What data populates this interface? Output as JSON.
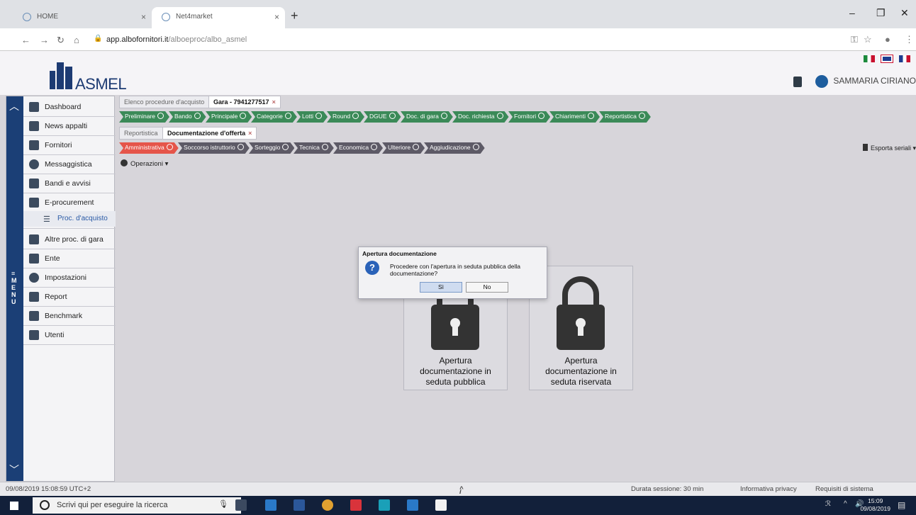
{
  "browser": {
    "tabs": [
      {
        "label": "HOME"
      },
      {
        "label": "Net4market"
      }
    ],
    "url_host": "app.albofornitori.it",
    "url_path": "/alboeproc/albo_asmel"
  },
  "header": {
    "logo_text": "ASMEL",
    "user_name": "SAMMARIA CIRIANO"
  },
  "sidebar": {
    "menu_vertical": "MENU",
    "items": [
      {
        "label": "Dashboard"
      },
      {
        "label": "News appalti"
      },
      {
        "label": "Fornitori"
      },
      {
        "label": "Messaggistica"
      },
      {
        "label": "Bandi e avvisi"
      },
      {
        "label": "E-procurement"
      },
      {
        "label": "Proc. d'acquisto"
      },
      {
        "label": "Altre proc. di gara"
      },
      {
        "label": "Ente"
      },
      {
        "label": "Impostazioni"
      },
      {
        "label": "Report"
      },
      {
        "label": "Benchmark"
      },
      {
        "label": "Utenti"
      }
    ]
  },
  "top_tabs": [
    {
      "label": "Elenco procedure d'acquisto"
    },
    {
      "label": "Gara - 7941277517"
    }
  ],
  "gara_steps": [
    "Preliminare",
    "Bando",
    "Principale",
    "Categorie",
    "Lotti",
    "Round",
    "DGUE",
    "Doc. di gara",
    "Doc. richiesta",
    "Fornitori",
    "Chiarimenti",
    "Reportistica"
  ],
  "sub_tabs": [
    {
      "label": "Reportistica"
    },
    {
      "label": "Documentazione d'offerta"
    }
  ],
  "doc_steps": [
    "Amministrativa",
    "Soccorso istruttorio",
    "Sorteggio",
    "Tecnica",
    "Economica",
    "Ulteriore",
    "Aggiudicazione"
  ],
  "toolbar": {
    "operations": "Operazioni",
    "export": "Esporta seriali"
  },
  "cards": [
    {
      "label": "Apertura documentazione in seduta pubblica"
    },
    {
      "label": "Apertura documentazione in seduta riservata"
    }
  ],
  "dialog": {
    "title": "Apertura documentazione",
    "message": "Procedere con l'apertura in seduta pubblica della documentazione?",
    "yes": "Sì",
    "no": "No"
  },
  "status": {
    "datetime": "09/08/2019 15:08:59 UTC+2",
    "info": "i",
    "session": "Durata sessione: 30 min",
    "privacy": "Informativa privacy",
    "requirements": "Requisiti di sistema"
  },
  "taskbar": {
    "search_placeholder": "Scrivi qui per eseguire la ricerca",
    "time": "15:09",
    "date": "09/08/2019"
  }
}
